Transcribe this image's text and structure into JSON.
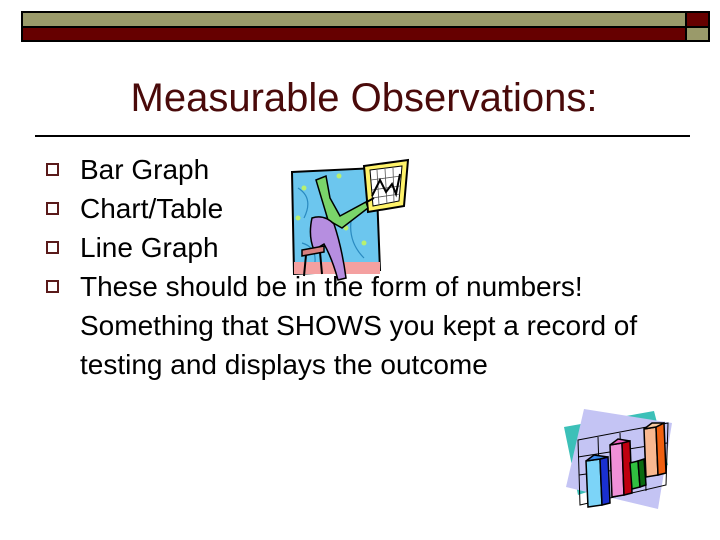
{
  "slide": {
    "title": "Measurable Observations:",
    "bullets": [
      {
        "text": "Bar Graph"
      },
      {
        "text": "Chart/Table"
      },
      {
        "text": "Line Graph"
      },
      {
        "text": "These should be in the form of numbers! Something that SHOWS you kept a record of testing and displays the outcome"
      }
    ],
    "bullet_icon": "hollow-square-bullet",
    "images": [
      {
        "name": "person-presenting-line-chart-clipart"
      },
      {
        "name": "3d-bar-chart-clipart"
      }
    ],
    "colors": {
      "title": "#4a0a0a",
      "band_olive": "#9a9a6a",
      "band_maroon": "#660000",
      "bullet_box": "#5a1a1a"
    }
  }
}
